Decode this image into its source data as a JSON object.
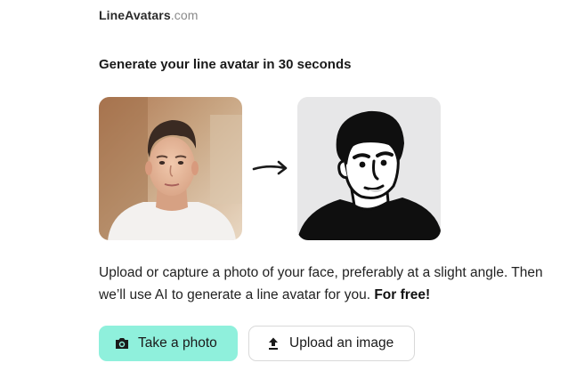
{
  "header": {
    "brand": "LineAvatars",
    "tld": ".com"
  },
  "main": {
    "headline": "Generate your line avatar in 30 seconds",
    "description_part1": "Upload or capture a photo of your face, preferably at a slight angle. Then we’ll use AI to generate a line avatar for you.",
    "description_bold": "For free!"
  },
  "actions": {
    "take_photo_label": "Take a photo",
    "upload_label": "Upload an image"
  },
  "icons": {
    "take_photo": "camera-icon",
    "upload": "upload-icon",
    "arrow": "arrow-right-icon"
  },
  "colors": {
    "take_photo_bg": "#8ff0dc",
    "avatar_bg": "#e7e7e8"
  }
}
